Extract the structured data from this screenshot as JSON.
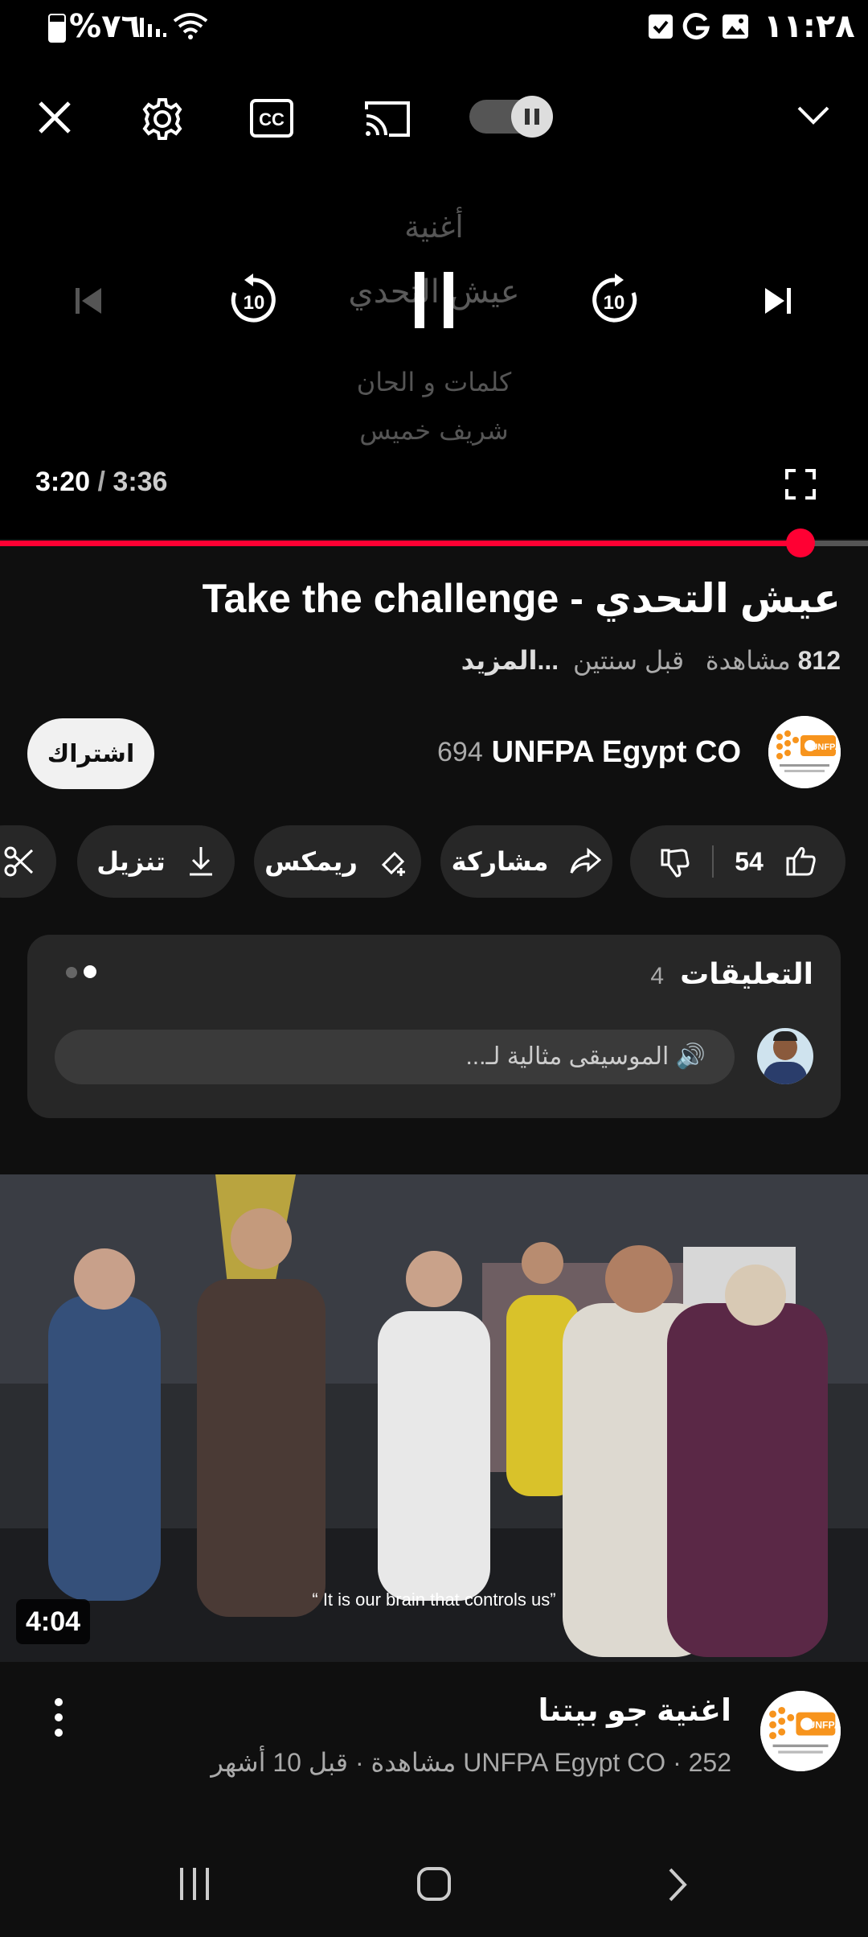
{
  "status_bar": {
    "battery": "%٧٦",
    "time": "١١:٢٨"
  },
  "player": {
    "video_overlay": {
      "line1": "أغنية",
      "line2": "عيش التحدي",
      "line3": "كلمات و الحان",
      "line4": "شريف خميس"
    },
    "current_time": "3:20",
    "time_separator": " / ",
    "total_time": "3:36",
    "progress": 0.922
  },
  "video": {
    "title": "عيش التحدي - Take the challenge",
    "views": "812",
    "views_label": "مشاهدة",
    "age": "قبل سنتين",
    "more": "...المزيد"
  },
  "channel": {
    "name": "UNFPA Egypt CO",
    "subscribers": "694",
    "subscribe_label": "اشتراك",
    "avatar_text": "UNFPA"
  },
  "actions": {
    "likes": "54",
    "share": "مشاركة",
    "remix": "ريمكس",
    "download": "تنزيل"
  },
  "comments": {
    "title": "التعليقات",
    "count": "4",
    "preview": "🔊 الموسيقى مثالية لـ..."
  },
  "next_video": {
    "thumbnail_caption": "“ It is our brain that controls us”",
    "duration": "4:04",
    "title": "اغنية جو بيتنا",
    "channel": "UNFPA Egypt CO",
    "views": "252 مشاهدة",
    "age": "قبل 10 أشهر",
    "separator": " · "
  },
  "colors": {
    "accent": "#ff0033",
    "background": "#0f0f0f",
    "surface": "#272727"
  }
}
